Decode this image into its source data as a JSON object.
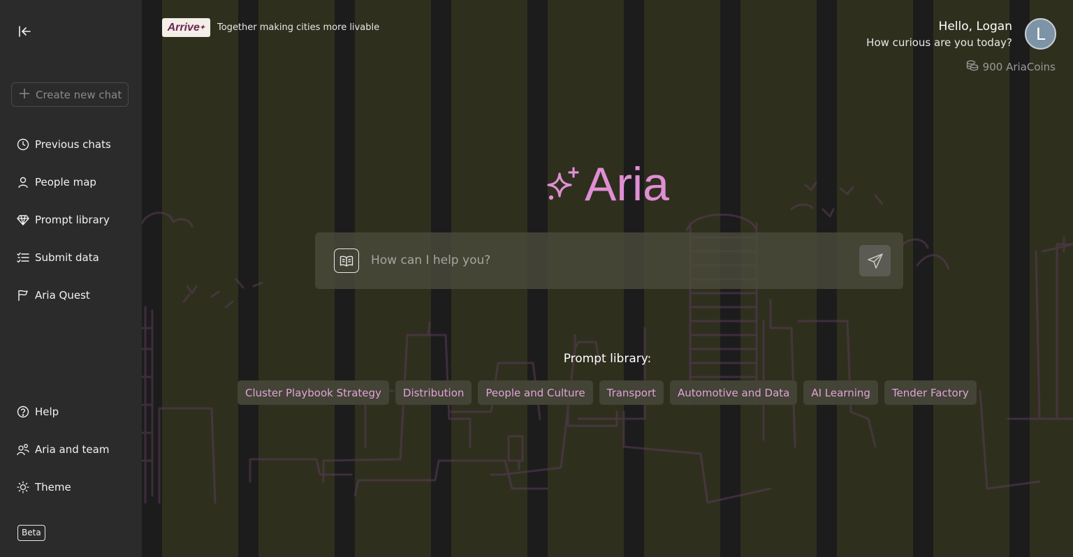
{
  "sidebar": {
    "new_chat_label": "Create new chat",
    "nav_items": [
      {
        "label": "Previous chats",
        "icon": "clock-icon"
      },
      {
        "label": "People map",
        "icon": "person-icon"
      },
      {
        "label": "Prompt library",
        "icon": "diamond-icon"
      },
      {
        "label": "Submit data",
        "icon": "checklist-icon"
      },
      {
        "label": "Aria Quest",
        "icon": "flag-icon"
      }
    ],
    "bottom_items": [
      {
        "label": "Help",
        "icon": "help-circle-icon"
      },
      {
        "label": "Aria and team",
        "icon": "team-icon"
      },
      {
        "label": "Theme",
        "icon": "sun-icon"
      }
    ],
    "beta_label": "Beta"
  },
  "header": {
    "brand_logo_text": "Arrive",
    "tagline": "Together making cities more livable",
    "greeting": "Hello, Logan",
    "greeting_sub": "How curious are you today?",
    "avatar_initial": "L",
    "coins_label": "900 AriaCoins"
  },
  "main": {
    "title": "Aria",
    "prompt_placeholder": "How can I help you?",
    "library_label": "Prompt library:",
    "chips": [
      "Cluster Playbook Strategy",
      "Distribution",
      "People and Culture",
      "Transport",
      "Automotive and Data",
      "AI Learning",
      "Tender Factory"
    ]
  },
  "colors": {
    "accent": "#e08fd4",
    "sidebar_bg": "#2b2b2b",
    "chip_bg": "#434336"
  }
}
